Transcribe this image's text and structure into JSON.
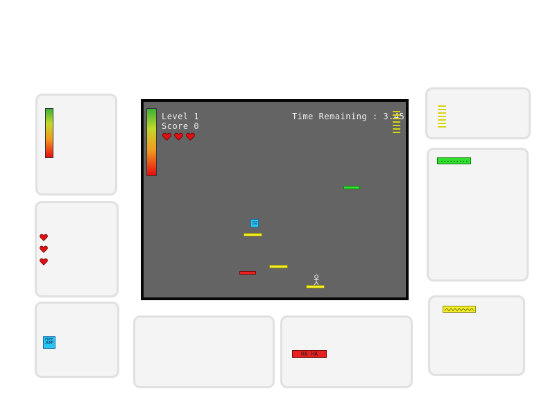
{
  "game": {
    "level_label": "Level 1",
    "score_label": "Score 0",
    "time_label": "Time Remaining : 3.45",
    "lives": 3,
    "free_box_text": "FREE\nJUMP",
    "colors": {
      "background": "#646464",
      "border": "#070707",
      "hud_text": "#ececec",
      "green_platform": "#2fe02c",
      "red_platform": "#ea2020",
      "yellow_platform": "#f1ed26",
      "free_box": "#29c6f2",
      "heart": "#e40f12"
    }
  },
  "legend": {
    "meter_card": {
      "item": "jump-power-meter"
    },
    "hearts_card": {
      "count": 3
    },
    "box_card": {
      "text": "FREE\nJUMP"
    },
    "red_card": {
      "text": "HA HA"
    },
    "ladder_card": {
      "item": "yellow-ladder"
    },
    "green_card": {
      "item": "green-platform"
    },
    "yellow_card": {
      "item": "yellow-platform"
    }
  }
}
